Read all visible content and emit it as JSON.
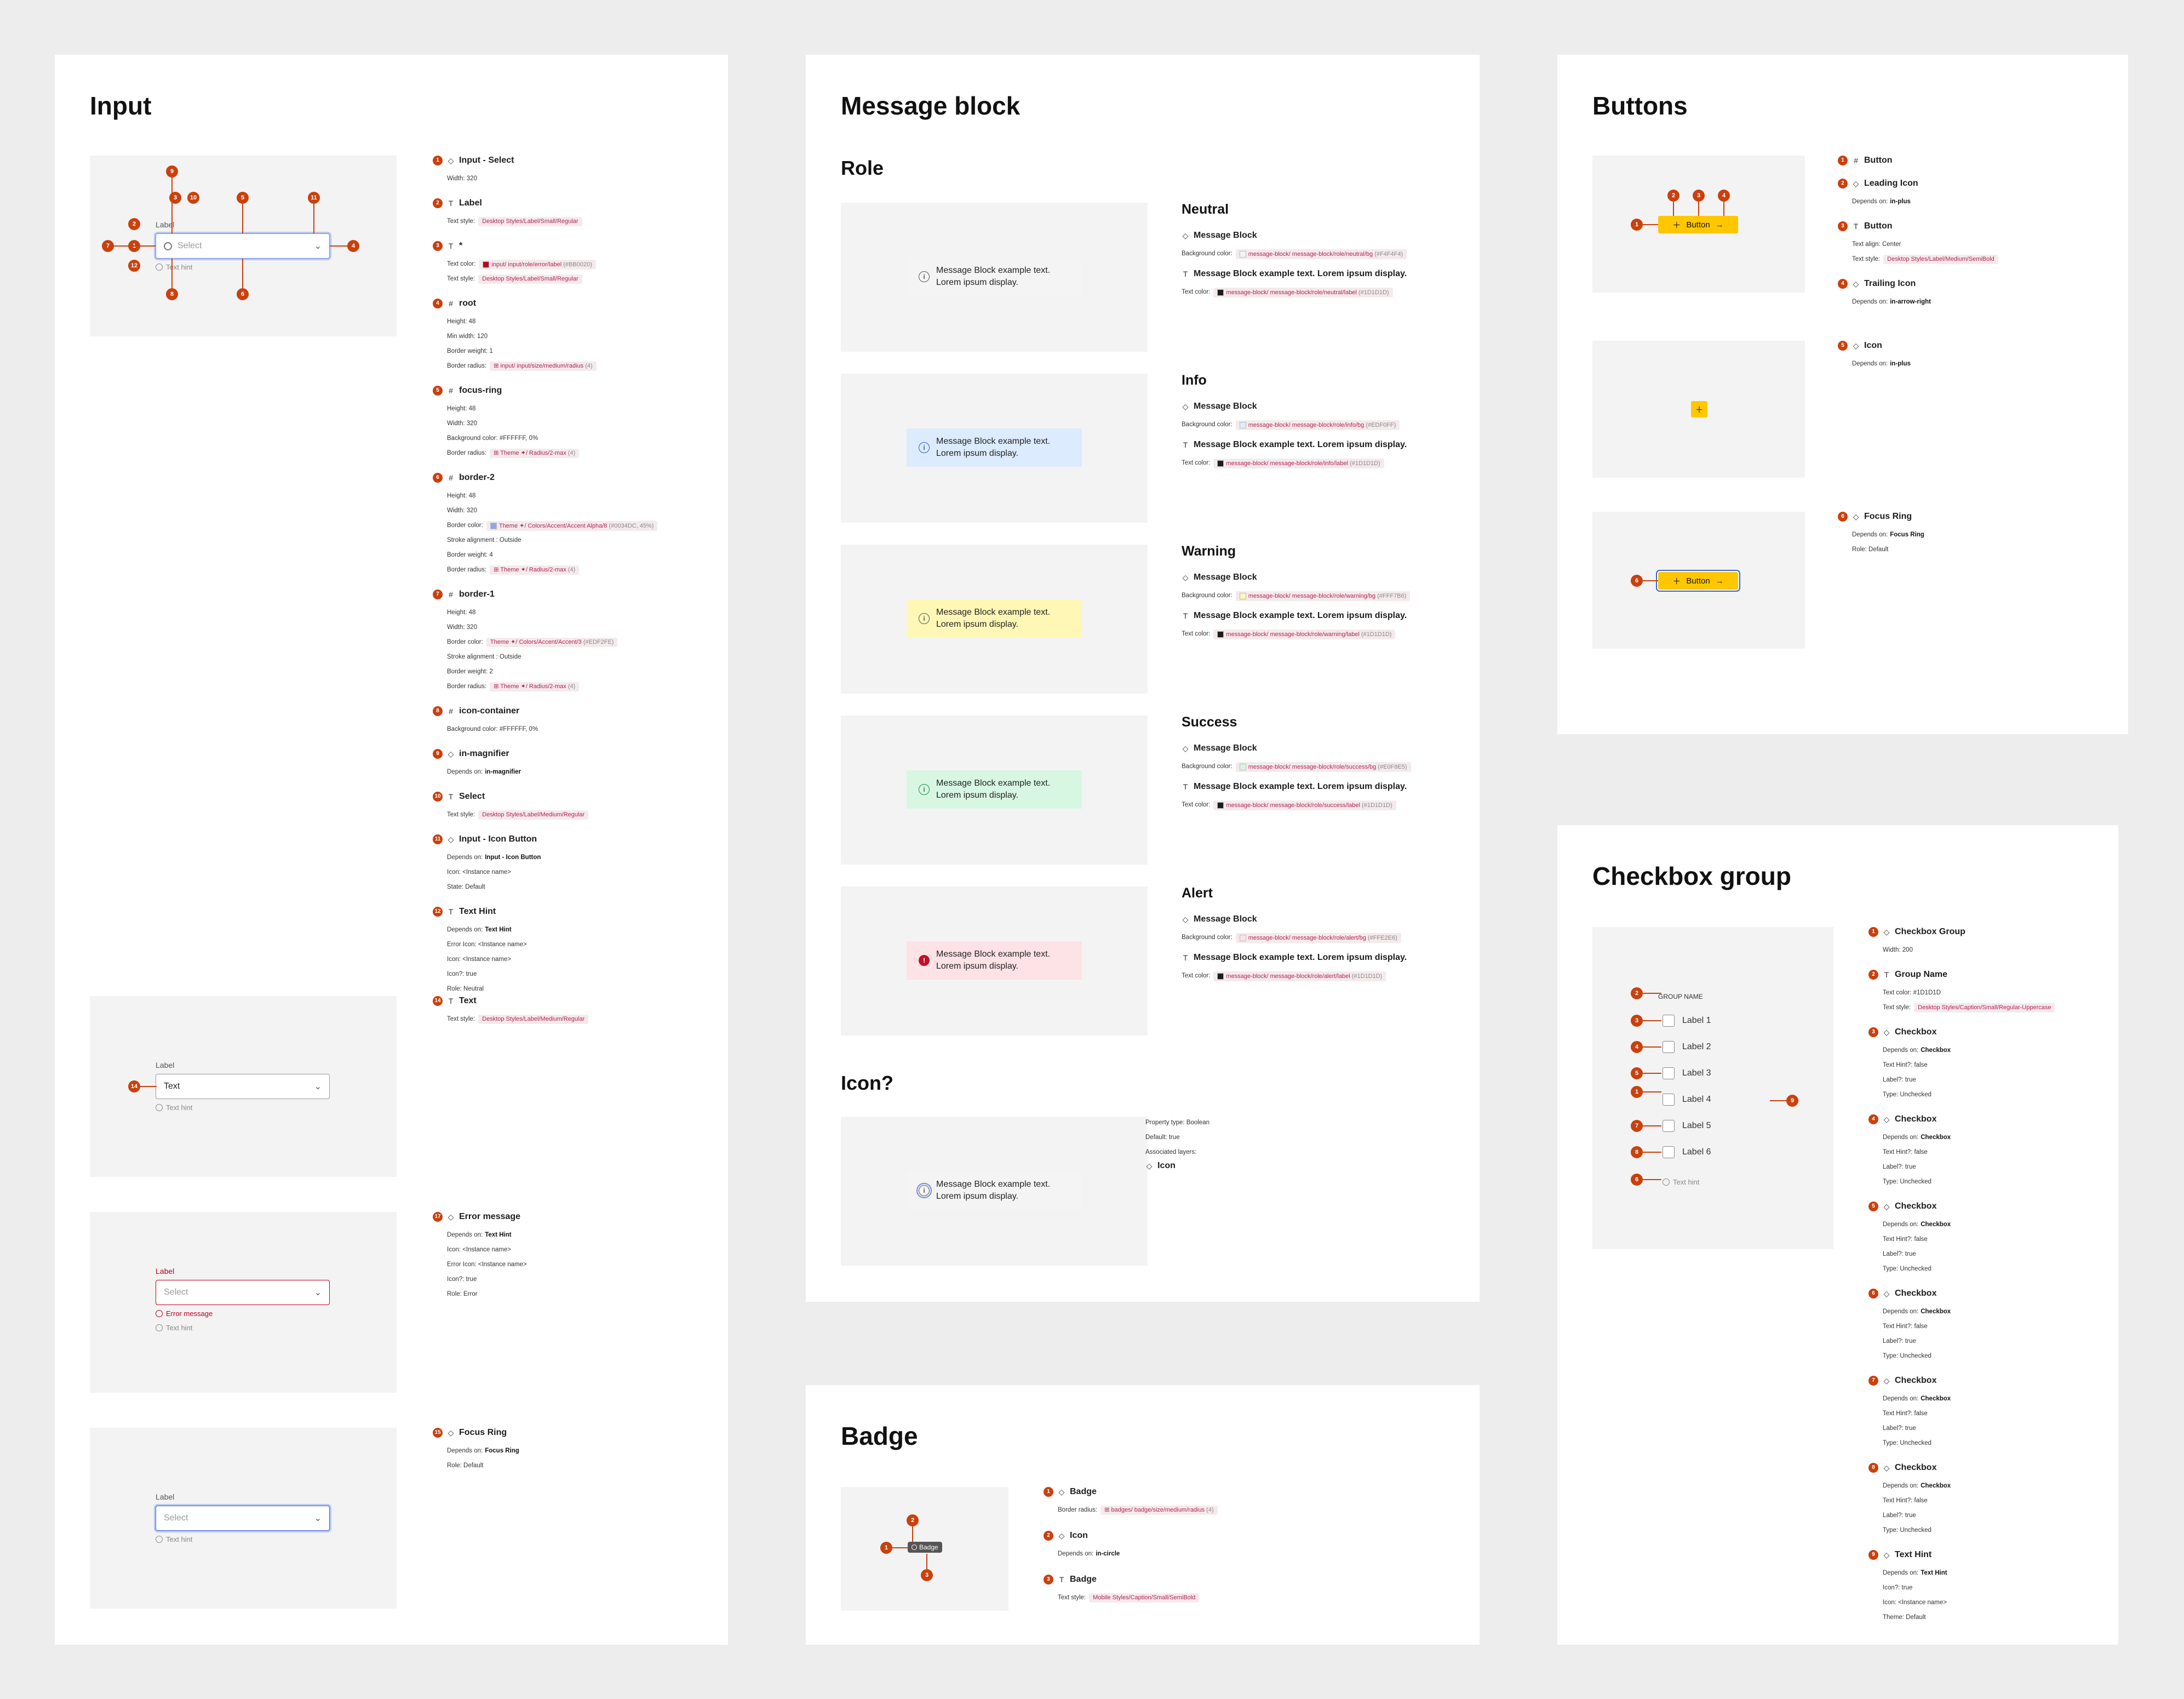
{
  "input": {
    "title": "Input",
    "canvas1": {
      "label": "Label",
      "placeholder": "Select",
      "hint": "Text hint"
    },
    "canvas2": {
      "label": "Label",
      "value": "Text",
      "hint": "Text hint"
    },
    "canvas3": {
      "label": "Label",
      "placeholder": "Select",
      "error": "Error message",
      "hint": "Text hint"
    },
    "canvas4": {
      "label": "Label",
      "placeholder": "Select",
      "hint": "Text hint"
    },
    "pins": [
      "9",
      "3",
      "10",
      "5",
      "11",
      "2",
      "7",
      "1",
      "4",
      "12",
      "8",
      "6",
      "14"
    ],
    "annotations": [
      {
        "n": "1",
        "icon": "◇",
        "title": "Input - Select",
        "rows": [
          {
            "k": "Width: 320"
          }
        ]
      },
      {
        "n": "2",
        "icon": "T",
        "title": "Label",
        "rows": [
          {
            "k": "Text style:",
            "tok": "Desktop Styles/Label/Small/Regular"
          }
        ]
      },
      {
        "n": "3",
        "icon": "T",
        "title": "*",
        "rows": [
          {
            "k": "Text color:",
            "tok": "input/ input/role/error/label",
            "g": "(#BB0020)",
            "sw": "#bb0020"
          },
          {
            "k": "Text style:",
            "tok": "Desktop Styles/Label/Small/Regular"
          }
        ]
      },
      {
        "n": "4",
        "icon": "#",
        "title": "root",
        "rows": [
          {
            "k": "Height: 48"
          },
          {
            "k": "Min width: 120"
          },
          {
            "k": "Border weight: 1"
          },
          {
            "k": "Border radius:",
            "tok": "⊞ input/ input/size/medium/radius",
            "g": "(4)"
          }
        ]
      },
      {
        "n": "5",
        "icon": "#",
        "title": "focus-ring",
        "rows": [
          {
            "k": "Height: 48"
          },
          {
            "k": "Width: 320"
          },
          {
            "k": "Background color: #FFFFFF, 0%"
          },
          {
            "k": "Border radius:",
            "tok": "⊞ Theme ✦/ Radius/2-max",
            "g": "(4)"
          }
        ]
      },
      {
        "n": "6",
        "icon": "#",
        "title": "border-2",
        "rows": [
          {
            "k": "Height: 48"
          },
          {
            "k": "Width: 320"
          },
          {
            "k": "Border color:",
            "tok": "Theme ✦/ Colors/Accent/Accent Alpha/8",
            "g": "(#0034DC, 45%)",
            "sw": "#8fa6ee"
          },
          {
            "k": "Stroke alignment : Outside"
          },
          {
            "k": "Border weight: 4"
          },
          {
            "k": "Border radius:",
            "tok": "⊞ Theme ✦/ Radius/2-max",
            "g": "(4)"
          }
        ]
      },
      {
        "n": "7",
        "icon": "#",
        "title": "border-1",
        "rows": [
          {
            "k": "Height: 48"
          },
          {
            "k": "Width: 320"
          },
          {
            "k": "Border color:",
            "tok": "Theme ✦/ Colors/Accent/Accent/3",
            "g": "(#EDF2FE)"
          },
          {
            "k": "Stroke alignment : Outside"
          },
          {
            "k": "Border weight: 2"
          },
          {
            "k": "Border radius:",
            "tok": "⊞ Theme ✦/ Radius/2-max",
            "g": "(4)"
          }
        ]
      },
      {
        "n": "8",
        "icon": "#",
        "title": "icon-container",
        "rows": [
          {
            "k": "Background color: #FFFFFF, 0%"
          }
        ]
      },
      {
        "n": "9",
        "icon": "◇",
        "title": "in-magnifier",
        "rows": [
          {
            "k": "Depends on:",
            "b": "in-magnifier"
          }
        ]
      },
      {
        "n": "10",
        "icon": "T",
        "title": "Select",
        "rows": [
          {
            "k": "Text style:",
            "tok": "Desktop Styles/Label/Medium/Regular"
          }
        ]
      },
      {
        "n": "11",
        "icon": "◇",
        "title": "Input - Icon Button",
        "rows": [
          {
            "k": "Depends on:",
            "b": "Input - Icon Button"
          },
          {
            "k": "Icon: <Instance name>"
          },
          {
            "k": "State: Default"
          }
        ]
      },
      {
        "n": "12",
        "icon": "T",
        "title": "Text Hint",
        "rows": [
          {
            "k": "Depends on:",
            "b": "Text Hint"
          },
          {
            "k": "Error Icon: <Instance name>"
          },
          {
            "k": "Icon: <Instance name>"
          },
          {
            "k": "Icon?: true"
          },
          {
            "k": "Role: Neutral"
          }
        ]
      }
    ],
    "anno14": {
      "n": "14",
      "icon": "T",
      "title": "Text",
      "rows": [
        {
          "k": "Text style:",
          "tok": "Desktop Styles/Label/Medium/Regular"
        }
      ]
    },
    "anno17": {
      "n": "17",
      "icon": "◇",
      "title": "Error message",
      "rows": [
        {
          "k": "Depends on:",
          "b": "Text Hint"
        },
        {
          "k": "Icon: <Instance name>"
        },
        {
          "k": "Error Icon: <Instance name>"
        },
        {
          "k": "Icon?: true"
        },
        {
          "k": "Role: Error"
        }
      ]
    },
    "anno15": {
      "n": "15",
      "icon": "◇",
      "title": "Focus Ring",
      "rows": [
        {
          "k": "Depends on:",
          "b": "Focus Ring"
        },
        {
          "k": "Role: Default"
        }
      ]
    }
  },
  "message": {
    "title": "Message block",
    "role_heading": "Role",
    "sample": "Message Block example text. Lorem ipsum display.",
    "roles": [
      {
        "name": "Neutral",
        "bg": "#f4f4f4",
        "icon": "i",
        "iconColor": "#555",
        "fill": false,
        "bgtok": "message-block/ message-block/role/neutral/bg",
        "bghex": "(#F4F4F4)",
        "labtok": "message-block/ message-block/role/neutral/label",
        "labhex": "(#1D1D1D)"
      },
      {
        "name": "Info",
        "bg": "#dcebfd",
        "icon": "i",
        "iconColor": "#2a5bd7",
        "fill": false,
        "bgtok": "message-block/ message-block/role/info/bg",
        "bghex": "(#EDF0FF)",
        "labtok": "message-block/ message-block/role/info/label",
        "labhex": "(#1D1D1D)"
      },
      {
        "name": "Warning",
        "bg": "#fff7b6",
        "icon": "i",
        "iconColor": "#555",
        "fill": false,
        "bgtok": "message-block/ message-block/role/warning/bg",
        "bghex": "(#FFF7B6)",
        "labtok": "message-block/ message-block/role/warning/label",
        "labhex": "(#1D1D1D)"
      },
      {
        "name": "Success",
        "bg": "#d8f7e3",
        "icon": "i",
        "iconColor": "#1b8a4a",
        "fill": false,
        "bgtok": "message-block/ message-block/role/success/bg",
        "bghex": "(#E0F8E5)",
        "labtok": "message-block/ message-block/role/success/label",
        "labhex": "(#1D1D1D)"
      },
      {
        "name": "Alert",
        "bg": "#fde2e6",
        "icon": "!",
        "iconColor": "#c0102a",
        "fill": true,
        "bgtok": "message-block/ message-block/role/alert/bg",
        "bghex": "(#FFE2E6)",
        "labtok": "message-block/ message-block/role/alert/label",
        "labhex": "(#1D1D1D)"
      }
    ],
    "labels": {
      "block": "Message Block",
      "bgcolor": "Background color:",
      "textline": "Message Block example text. Lorem ipsum display.",
      "textcolor": "Text color:"
    },
    "icon_heading": "Icon?",
    "icon_props": [
      "Property type: Boolean",
      "Default: true",
      "Associated layers:"
    ],
    "icon_layer": "Icon"
  },
  "badge": {
    "title": "Badge",
    "chip": "Badge",
    "pins": [
      "2",
      "1",
      "3"
    ],
    "annotations": [
      {
        "n": "1",
        "icon": "◇",
        "title": "Badge",
        "rows": [
          {
            "k": "Border radius:",
            "tok": "⊞ badges/ badge/size/medium/radius",
            "g": "(4)"
          }
        ]
      },
      {
        "n": "2",
        "icon": "◇",
        "title": "Icon",
        "rows": [
          {
            "k": "Depends on:",
            "b": "in-circle"
          }
        ]
      },
      {
        "n": "3",
        "icon": "T",
        "title": "Badge",
        "rows": [
          {
            "k": "Text style:",
            "tok": "Mobile Styles/Caption/Small/SemiBold"
          }
        ]
      }
    ]
  },
  "buttons": {
    "title": "Buttons",
    "label": "Button",
    "pins": [
      "2",
      "3",
      "4",
      "1",
      "5",
      "6"
    ],
    "annotations": [
      {
        "n": "1",
        "icon": "#",
        "title": "Button",
        "rows": []
      },
      {
        "n": "2",
        "icon": "◇",
        "title": "Leading Icon",
        "rows": [
          {
            "k": "Depends on:",
            "b": "in-plus"
          }
        ]
      },
      {
        "n": "3",
        "icon": "T",
        "title": "Button",
        "rows": [
          {
            "k": "Text align: Center"
          },
          {
            "k": "Text style:",
            "tok": "Desktop Styles/Label/Medium/SemiBold"
          }
        ]
      },
      {
        "n": "4",
        "icon": "◇",
        "title": "Trailing Icon",
        "rows": [
          {
            "k": "Depends on:",
            "b": "in-arrow-right"
          }
        ]
      }
    ],
    "anno5": {
      "n": "5",
      "icon": "◇",
      "title": "Icon",
      "rows": [
        {
          "k": "Depends on:",
          "b": "in-plus"
        }
      ]
    },
    "anno6": {
      "n": "6",
      "icon": "◇",
      "title": "Focus Ring",
      "rows": [
        {
          "k": "Depends on:",
          "b": "Focus Ring"
        },
        {
          "k": "Role: Default"
        }
      ]
    }
  },
  "checkbox": {
    "title": "Checkbox group",
    "group_name": "GROUP NAME",
    "items": [
      "Label 1",
      "Label 2",
      "Label 3",
      "Label 4",
      "Label 5",
      "Label 6"
    ],
    "hint": "Text hint",
    "pins": [
      "2",
      "3",
      "4",
      "5",
      "1",
      "7",
      "8",
      "6",
      "9"
    ],
    "annotations": [
      {
        "n": "1",
        "icon": "◇",
        "title": "Checkbox Group",
        "rows": [
          {
            "k": "Width: 200"
          }
        ]
      },
      {
        "n": "2",
        "icon": "T",
        "title": "Group Name",
        "rows": [
          {
            "k": "Text color: #1D1D1D"
          },
          {
            "k": "Text style:",
            "tok": "Desktop Styles/Caption/Small/Regular-Uppercase"
          }
        ]
      },
      {
        "n": "3",
        "icon": "◇",
        "title": "Checkbox",
        "rows": [
          {
            "k": "Depends on:",
            "b": "Checkbox"
          },
          {
            "k": "Text Hint?: false"
          },
          {
            "k": "Label?: true"
          },
          {
            "k": "Type: Unchecked"
          }
        ]
      },
      {
        "n": "4",
        "icon": "◇",
        "title": "Checkbox",
        "rows": [
          {
            "k": "Depends on:",
            "b": "Checkbox"
          },
          {
            "k": "Text Hint?: false"
          },
          {
            "k": "Label?: true"
          },
          {
            "k": "Type: Unchecked"
          }
        ]
      },
      {
        "n": "5",
        "icon": "◇",
        "title": "Checkbox",
        "rows": [
          {
            "k": "Depends on:",
            "b": "Checkbox"
          },
          {
            "k": "Text Hint?: false"
          },
          {
            "k": "Label?: true"
          },
          {
            "k": "Type: Unchecked"
          }
        ]
      },
      {
        "n": "6",
        "icon": "◇",
        "title": "Checkbox",
        "rows": [
          {
            "k": "Depends on:",
            "b": "Checkbox"
          },
          {
            "k": "Text Hint?: false"
          },
          {
            "k": "Label?: true"
          },
          {
            "k": "Type: Unchecked"
          }
        ]
      },
      {
        "n": "7",
        "icon": "◇",
        "title": "Checkbox",
        "rows": [
          {
            "k": "Depends on:",
            "b": "Checkbox"
          },
          {
            "k": "Text Hint?: false"
          },
          {
            "k": "Label?: true"
          },
          {
            "k": "Type: Unchecked"
          }
        ]
      },
      {
        "n": "8",
        "icon": "◇",
        "title": "Checkbox",
        "rows": [
          {
            "k": "Depends on:",
            "b": "Checkbox"
          },
          {
            "k": "Text Hint?: false"
          },
          {
            "k": "Label?: true"
          },
          {
            "k": "Type: Unchecked"
          }
        ]
      },
      {
        "n": "9",
        "icon": "◇",
        "title": "Text Hint",
        "rows": [
          {
            "k": "Depends on:",
            "b": "Text Hint"
          },
          {
            "k": "Icon?: true"
          },
          {
            "k": "Icon: <Instance name>"
          },
          {
            "k": "Theme: Default"
          }
        ]
      }
    ]
  }
}
